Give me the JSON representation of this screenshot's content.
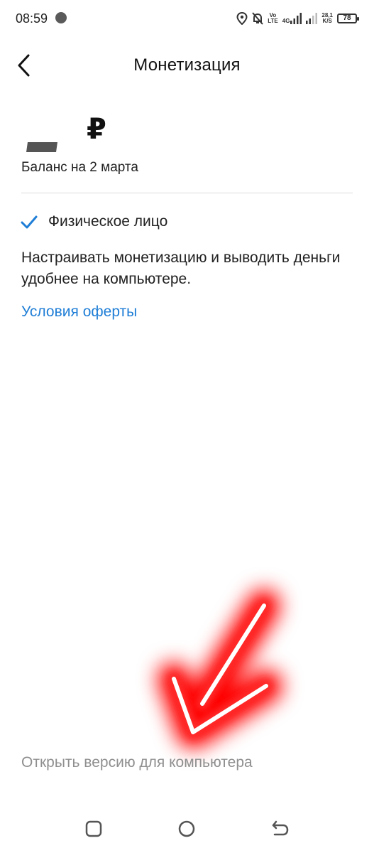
{
  "status_bar": {
    "time": "08:59",
    "network_top": "Vo",
    "network_bottom": "LTE",
    "network_gen": "4G",
    "speed_value": "28,1",
    "speed_unit": "K/S",
    "battery": "78"
  },
  "header": {
    "title": "Монетизация"
  },
  "balance": {
    "currency": "₽",
    "caption": "Баланс на 2 марта"
  },
  "entity": {
    "label": "Физическое лицо"
  },
  "info": {
    "text": "Настраивать монетизацию и выводить деньги удобнее на компьютере."
  },
  "links": {
    "offer": "Условия оферты",
    "desktop_version": "Открыть версию для компьютера"
  },
  "colors": {
    "accent": "#1f7ed6",
    "annotation": "#ff1a1a",
    "muted": "#8f8f8f"
  },
  "icons": {
    "back": "chevron-left-icon",
    "check": "check-icon",
    "nav_recent": "square-icon",
    "nav_home": "circle-icon",
    "nav_back": "back-arrow-icon"
  }
}
